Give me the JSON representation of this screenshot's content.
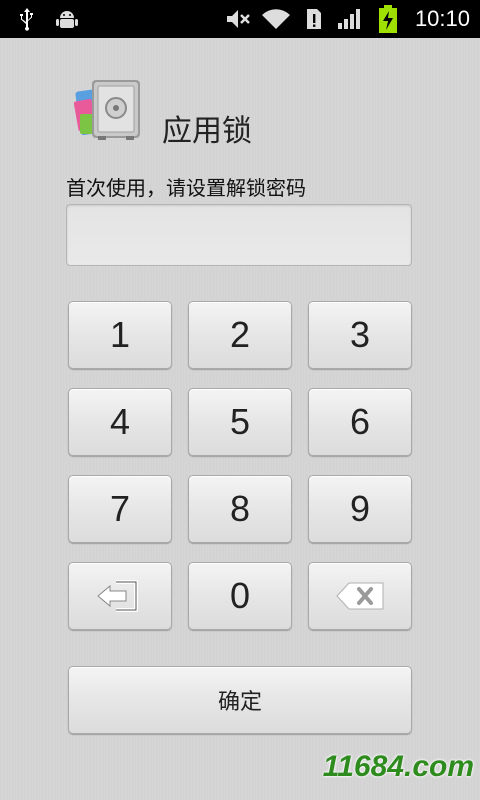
{
  "status_bar": {
    "time": "10:10",
    "icons": [
      "usb-icon",
      "android-debug-icon",
      "mute-icon",
      "wifi-icon",
      "sim-alert-icon",
      "signal-icon",
      "battery-charging-icon"
    ]
  },
  "header": {
    "title": "应用锁",
    "logo_icon": "app-lock-safe-icon"
  },
  "prompt": "首次使用，请设置解锁密码",
  "pin_input": {
    "value": "",
    "placeholder": ""
  },
  "keypad": {
    "k1": "1",
    "k2": "2",
    "k3": "3",
    "k4": "4",
    "k5": "5",
    "k6": "6",
    "k7": "7",
    "k8": "8",
    "k9": "9",
    "k0": "0",
    "exit_icon": "exit-icon",
    "backspace_icon": "backspace-icon"
  },
  "confirm_label": "确定",
  "watermark": "11684.com",
  "colors": {
    "status_bar": "#000000",
    "background": "#d4d4d4",
    "watermark": "#2e8b1e"
  }
}
